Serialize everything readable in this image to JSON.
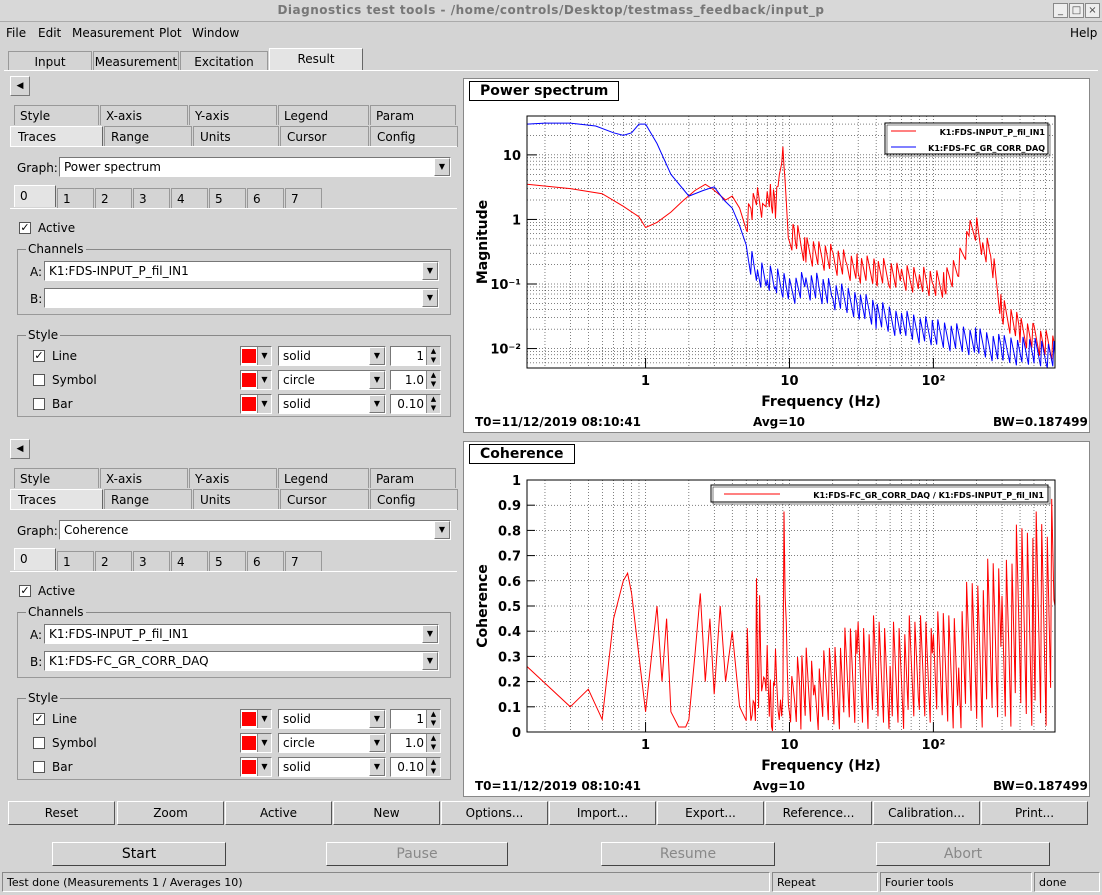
{
  "window": {
    "title": "Diagnostics test tools - /home/controls/Desktop/testmass_feedback/input_p"
  },
  "menu": {
    "file": "File",
    "edit": "Edit",
    "measurement": "Measurement",
    "plot": "Plot",
    "window": "Window",
    "help": "Help"
  },
  "main_tabs": {
    "input": "Input",
    "measurement": "Measurement",
    "excitation": "Excitation",
    "result": "Result"
  },
  "panels": [
    {
      "tabs_row1": [
        "Style",
        "X-axis",
        "Y-axis",
        "Legend",
        "Param"
      ],
      "tabs_row2": [
        "Traces",
        "Range",
        "Units",
        "Cursor",
        "Config"
      ],
      "graph_label": "Graph:",
      "graph_value": "Power spectrum",
      "trace_tabs": [
        "0",
        "1",
        "2",
        "3",
        "4",
        "5",
        "6",
        "7"
      ],
      "active_label": "Active",
      "channels_label": "Channels",
      "channel_a_label": "A:",
      "channel_a": "K1:FDS-INPUT_P_fil_IN1",
      "channel_b_label": "B:",
      "channel_b": "",
      "style_label": "Style",
      "line_label": "Line",
      "line_style": "solid",
      "line_width": "1",
      "symbol_label": "Symbol",
      "symbol_style": "circle",
      "symbol_size": "1.0",
      "bar_label": "Bar",
      "bar_style": "solid",
      "bar_width": "0.10"
    },
    {
      "tabs_row1": [
        "Style",
        "X-axis",
        "Y-axis",
        "Legend",
        "Param"
      ],
      "tabs_row2": [
        "Traces",
        "Range",
        "Units",
        "Cursor",
        "Config"
      ],
      "graph_label": "Graph:",
      "graph_value": "Coherence",
      "trace_tabs": [
        "0",
        "1",
        "2",
        "3",
        "4",
        "5",
        "6",
        "7"
      ],
      "active_label": "Active",
      "channels_label": "Channels",
      "channel_a_label": "A:",
      "channel_a": "K1:FDS-INPUT_P_fil_IN1",
      "channel_b_label": "B:",
      "channel_b": "K1:FDS-FC_GR_CORR_DAQ",
      "style_label": "Style",
      "line_label": "Line",
      "line_style": "solid",
      "line_width": "1",
      "symbol_label": "Symbol",
      "symbol_style": "circle",
      "symbol_size": "1.0",
      "bar_label": "Bar",
      "bar_style": "solid",
      "bar_width": "0.10"
    }
  ],
  "plots": [
    {
      "title": "Power spectrum",
      "xlabel": "Frequency (Hz)",
      "ylabel": "Magnitude",
      "t0": "T0=11/12/2019 08:10:41",
      "avg": "Avg=10",
      "bw": "BW=0.187499",
      "legend": [
        "K1:FDS-INPUT_P_fil_IN1",
        "K1:FDS-FC_GR_CORR_DAQ"
      ],
      "xticks": [
        "1",
        "10",
        "10²"
      ],
      "yticks": [
        "10",
        "1",
        "10⁻¹",
        "10⁻²"
      ]
    },
    {
      "title": "Coherence",
      "xlabel": "Frequency (Hz)",
      "ylabel": "Coherence",
      "t0": "T0=11/12/2019 08:10:41",
      "avg": "Avg=10",
      "bw": "BW=0.187499",
      "legend": [
        "K1:FDS-FC_GR_CORR_DAQ / K1:FDS-INPUT_P_fil_IN1"
      ],
      "xticks": [
        "1",
        "10",
        "10²"
      ],
      "yticks": [
        "0",
        "0.1",
        "0.2",
        "0.3",
        "0.4",
        "0.5",
        "0.6",
        "0.7",
        "0.8",
        "0.9",
        "1"
      ]
    }
  ],
  "toolbar": [
    "Reset",
    "Zoom",
    "Active",
    "New",
    "Options...",
    "Import...",
    "Export...",
    "Reference...",
    "Calibration...",
    "Print..."
  ],
  "controls": {
    "start": "Start",
    "pause": "Pause",
    "resume": "Resume",
    "abort": "Abort"
  },
  "statusbar": {
    "message": "Test done (Measurements 1 / Averages 10)",
    "mode": "Repeat",
    "tool": "Fourier tools",
    "state": "done"
  },
  "colors": {
    "trace_red": "#ff0000",
    "trace_blue": "#0000ff"
  },
  "chart_data": [
    {
      "type": "line",
      "title": "Power spectrum",
      "xlabel": "Frequency (Hz)",
      "ylabel": "Magnitude",
      "xscale": "log",
      "yscale": "log",
      "xlim": [
        0.15,
        700
      ],
      "ylim": [
        0.005,
        40
      ],
      "grid": true,
      "legend_position": "top-right",
      "series": [
        {
          "name": "K1:FDS-INPUT_P_fil_IN1",
          "color": "#ff0000",
          "x": [
            0.15,
            0.3,
            0.5,
            0.7,
            0.9,
            1.0,
            1.2,
            1.5,
            1.8,
            2.2,
            2.6,
            2.9,
            3.2,
            3.6,
            4.0,
            4.5,
            5.0,
            5.5,
            6.0,
            6.5,
            7.0,
            7.5,
            8.0,
            8.5,
            9.0,
            9.3,
            10,
            11,
            13,
            16,
            20,
            25,
            30,
            40,
            50,
            60,
            80,
            100,
            120,
            150,
            180,
            200,
            220,
            250,
            300,
            400,
            500,
            700
          ],
          "y": [
            3.5,
            3.0,
            2.5,
            1.6,
            1.1,
            0.75,
            0.9,
            1.3,
            1.9,
            2.8,
            3.5,
            3.0,
            2.5,
            2.0,
            2.3,
            1.5,
            1.0,
            1.7,
            2.2,
            1.5,
            2.8,
            2.0,
            1.6,
            3.0,
            10.0,
            4.0,
            0.5,
            0.6,
            0.35,
            0.3,
            0.25,
            0.2,
            0.18,
            0.16,
            0.15,
            0.12,
            0.12,
            0.1,
            0.1,
            0.2,
            0.6,
            0.8,
            0.4,
            0.3,
            0.04,
            0.02,
            0.015,
            0.01
          ]
        },
        {
          "name": "K1:FDS-FC_GR_CORR_DAQ",
          "color": "#0000ff",
          "x": [
            0.15,
            0.2,
            0.3,
            0.45,
            0.6,
            0.7,
            0.8,
            0.9,
            1.0,
            1.2,
            1.5,
            2.0,
            2.5,
            3.0,
            3.5,
            4.0,
            4.5,
            5.0,
            6.0,
            7.0,
            8.0,
            9.0,
            10,
            13,
            16,
            20,
            30,
            40,
            60,
            100,
            200,
            300,
            500,
            700
          ],
          "y": [
            30,
            31,
            31,
            28,
            22,
            20,
            22,
            30,
            30,
            15,
            5,
            2.3,
            2.8,
            3.2,
            2.0,
            1.5,
            0.8,
            0.3,
            0.15,
            0.13,
            0.12,
            0.1,
            0.08,
            0.1,
            0.09,
            0.07,
            0.05,
            0.035,
            0.025,
            0.018,
            0.013,
            0.01,
            0.009,
            0.008
          ]
        }
      ]
    },
    {
      "type": "line",
      "title": "Coherence",
      "xlabel": "Frequency (Hz)",
      "ylabel": "Coherence",
      "xscale": "log",
      "xlim": [
        0.15,
        700
      ],
      "ylim": [
        0,
        1
      ],
      "grid": true,
      "legend_position": "top-right",
      "series": [
        {
          "name": "K1:FDS-FC_GR_CORR_DAQ / K1:FDS-INPUT_P_fil_IN1",
          "color": "#ff0000",
          "x": [
            0.15,
            0.3,
            0.4,
            0.5,
            0.6,
            0.7,
            0.75,
            0.8,
            0.9,
            1.0,
            1.1,
            1.2,
            1.3,
            1.4,
            1.5,
            1.7,
            1.9,
            2.0,
            2.2,
            2.4,
            2.6,
            2.8,
            3.0,
            3.3,
            3.6,
            4.0,
            4.5,
            5.0,
            5.5,
            6.0,
            6.5,
            7.0,
            7.5,
            8.0,
            8.5,
            9.0,
            9.5,
            10,
            12,
            15,
            20,
            30,
            50,
            80,
            100,
            150,
            200,
            300,
            500,
            700
          ],
          "y": [
            0.26,
            0.1,
            0.17,
            0.05,
            0.45,
            0.6,
            0.63,
            0.55,
            0.3,
            0.08,
            0.3,
            0.5,
            0.2,
            0.45,
            0.08,
            0.02,
            0.02,
            0.05,
            0.3,
            0.55,
            0.2,
            0.45,
            0.15,
            0.5,
            0.2,
            0.4,
            0.1,
            0.3,
            0.05,
            0.45,
            0.1,
            0.3,
            0.05,
            0.2,
            0.05,
            0.6,
            0.3,
            0.1,
            0.2,
            0.15,
            0.2,
            0.25,
            0.25,
            0.25,
            0.25,
            0.3,
            0.35,
            0.4,
            0.5,
            0.5
          ]
        }
      ]
    }
  ]
}
